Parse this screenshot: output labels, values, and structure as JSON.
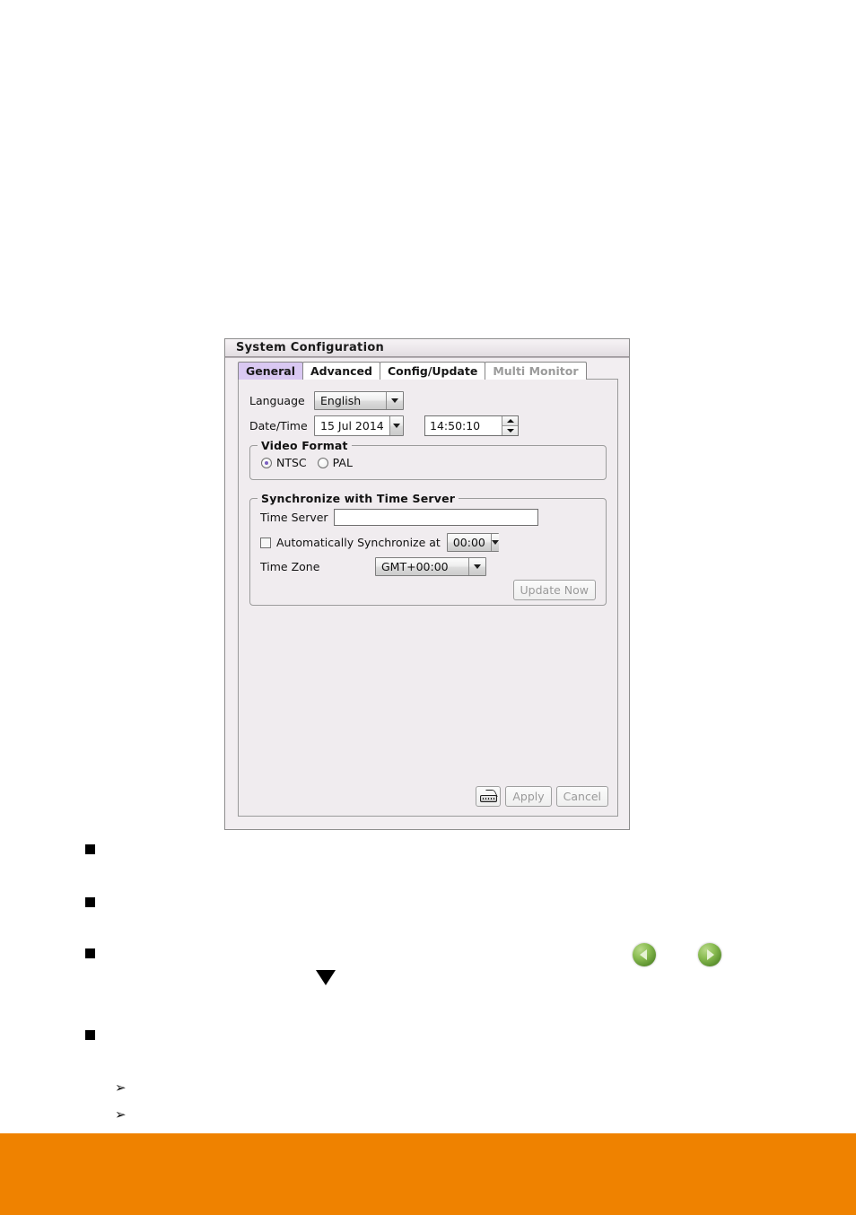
{
  "dialog": {
    "title": "System Configuration",
    "tabs": [
      {
        "label": "General",
        "state": "selected"
      },
      {
        "label": "Advanced",
        "state": "normal"
      },
      {
        "label": "Config/Update",
        "state": "normal"
      },
      {
        "label": "Multi Monitor",
        "state": "disabled"
      }
    ],
    "general": {
      "language_label": "Language",
      "language_value": "English",
      "datetime_label": "Date/Time",
      "date_value": "15 Jul 2014",
      "time_value": "14:50:10",
      "video_format": {
        "legend": "Video Format",
        "options": [
          {
            "label": "NTSC",
            "checked": true
          },
          {
            "label": "PAL",
            "checked": false
          }
        ]
      },
      "time_server_group": {
        "legend": "Synchronize with Time Server",
        "time_server_label": "Time Server",
        "time_server_value": "",
        "auto_sync_label": "Automatically Synchronize at",
        "auto_sync_checked": false,
        "auto_sync_time": "00:00",
        "time_zone_label": "Time Zone",
        "time_zone_value": "GMT+00:00",
        "update_now_label": "Update Now"
      }
    },
    "footer": {
      "keyboard_icon": "keyboard-icon",
      "apply_label": "Apply",
      "cancel_label": "Cancel"
    }
  },
  "page": {
    "square_bullets": [
      "square-bullet",
      "square-bullet",
      "square-bullet",
      "square-bullet"
    ],
    "arrow_bullets": [
      "arrow-bullet",
      "arrow-bullet"
    ],
    "down_triangle": "down-triangle-icon",
    "nav_back": "back-arrow-icon",
    "nav_forward": "forward-arrow-icon",
    "arrow_glyph": "➢"
  },
  "colors": {
    "accent_tab": "#d9c8f2",
    "radio_dot": "#7b5fc0",
    "band": "#ef8200",
    "dialog_bg": "#f0ecef",
    "nav_green": "#6fa83c"
  }
}
